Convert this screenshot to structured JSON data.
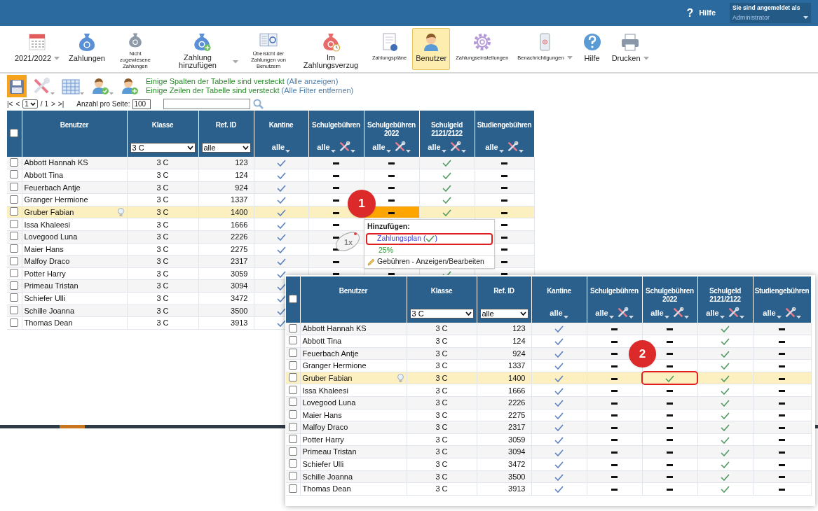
{
  "topbar": {
    "help_glyph": "?",
    "help": "Hilfe",
    "login_label": "Sie sind angemeldet als",
    "login_user": "Administrator"
  },
  "toolbar": [
    {
      "kind": "calendar",
      "label": "2021/2022",
      "dropdown": true,
      "minor": false,
      "selected": false
    },
    {
      "kind": "bag",
      "label": "Zahlungen",
      "dropdown": false,
      "minor": false,
      "selected": false
    },
    {
      "kind": "bag-question",
      "label": "Nicht zugewiesene Zahlungen",
      "dropdown": false,
      "minor": true,
      "selected": false
    },
    {
      "kind": "bag-add",
      "label": "Zahlung hinzufügen",
      "dropdown": true,
      "minor": false,
      "selected": false
    },
    {
      "kind": "book",
      "label": "Übersicht der Zahlungen von Benutzern",
      "dropdown": false,
      "minor": true,
      "selected": false
    },
    {
      "kind": "bag-clock",
      "label": "Im Zahlungsverzug",
      "dropdown": false,
      "minor": false,
      "selected": false
    },
    {
      "kind": "document",
      "label": "Zahlungspläne",
      "dropdown": false,
      "minor": true,
      "selected": false
    },
    {
      "kind": "user",
      "label": "Benutzer",
      "dropdown": false,
      "minor": false,
      "selected": true
    },
    {
      "kind": "gear",
      "label": "Zahlungseinstellungen",
      "dropdown": false,
      "minor": true,
      "selected": false
    },
    {
      "kind": "phone",
      "label": "Benachrichtigungen",
      "dropdown": true,
      "minor": true,
      "selected": false
    },
    {
      "kind": "help",
      "label": "Hilfe",
      "dropdown": false,
      "minor": false,
      "selected": false
    },
    {
      "kind": "printer",
      "label": "Drucken",
      "dropdown": true,
      "minor": false,
      "selected": false
    }
  ],
  "subtoolbar": {
    "tools": [
      {
        "kind": "save",
        "selected": true,
        "dropdown": false
      },
      {
        "kind": "tools",
        "selected": false,
        "dropdown": true
      },
      {
        "kind": "grid",
        "selected": false,
        "dropdown": true
      },
      {
        "kind": "user-check",
        "selected": false,
        "dropdown": true
      },
      {
        "kind": "user-add",
        "selected": false,
        "dropdown": false
      }
    ],
    "notices": [
      {
        "text": "Einige Spalten der Tabelle sind versteckt",
        "link": "(Alle anzeigen)"
      },
      {
        "text": "Einige Zeilen der Tabelle sind versteckt",
        "link": "(Alle Filter entfernen)"
      }
    ]
  },
  "pager": {
    "first": "|<",
    "prev": "<",
    "page": "1",
    "total": "/ 1",
    "next": ">",
    "last": ">|",
    "per_page_label": "Anzahl pro Seite:",
    "per_page": "100"
  },
  "table": {
    "all_checked": false,
    "columns": [
      {
        "label": "Benutzer",
        "kind": "name"
      },
      {
        "label": "Klasse",
        "kind": "select",
        "filter": "3 C"
      },
      {
        "label": "Ref. ID",
        "kind": "select",
        "filter": "alle"
      },
      {
        "label": "Kantine",
        "kind": "fee",
        "filter": "alle",
        "tools": false
      },
      {
        "label": "Schulgebühren",
        "kind": "fee",
        "filter": "alle",
        "tools": true
      },
      {
        "label": "Schulgebühren 2022",
        "kind": "fee",
        "filter": "alle",
        "tools": true
      },
      {
        "label": "Schulgeld 2121/2122",
        "kind": "fee",
        "filter": "alle",
        "tools": true
      },
      {
        "label": "Studiengebühren",
        "kind": "fee",
        "filter": "alle",
        "tools": true
      }
    ],
    "rows": [
      {
        "name": "Abbott Hannah KS",
        "klasse": "3 C",
        "ref": "123",
        "checked": false,
        "selected": false,
        "hint": false,
        "cells": {
          "kantine": {
            "kind": "booked"
          },
          "schulgebuehren": {
            "kind": "open"
          },
          "schulgebuehren_2022": {
            "kind": "open"
          },
          "schulgeld": {
            "kind": "paid"
          },
          "studiengebuehren": {
            "kind": "open"
          }
        }
      },
      {
        "name": "Abbott Tina",
        "klasse": "3 C",
        "ref": "124",
        "checked": false,
        "selected": false,
        "hint": false,
        "cells": {
          "kantine": {
            "kind": "booked"
          },
          "schulgebuehren": {
            "kind": "open"
          },
          "schulgebuehren_2022": {
            "kind": "open"
          },
          "schulgeld": {
            "kind": "paid"
          },
          "studiengebuehren": {
            "kind": "open"
          }
        }
      },
      {
        "name": "Feuerbach Antje",
        "klasse": "3 C",
        "ref": "924",
        "checked": false,
        "selected": false,
        "hint": false,
        "cells": {
          "kantine": {
            "kind": "booked"
          },
          "schulgebuehren": {
            "kind": "open"
          },
          "schulgebuehren_2022": {
            "kind": "open"
          },
          "schulgeld": {
            "kind": "paid"
          },
          "studiengebuehren": {
            "kind": "open"
          }
        }
      },
      {
        "name": "Granger Hermione",
        "klasse": "3 C",
        "ref": "1337",
        "checked": false,
        "selected": false,
        "hint": false,
        "cells": {
          "kantine": {
            "kind": "booked"
          },
          "schulgebuehren": {
            "kind": "open"
          },
          "schulgebuehren_2022": {
            "kind": "open"
          },
          "schulgeld": {
            "kind": "paid"
          },
          "studiengebuehren": {
            "kind": "open"
          }
        }
      },
      {
        "name": "Gruber Fabian",
        "klasse": "3 C",
        "ref": "1400",
        "checked": false,
        "selected": true,
        "hint": true,
        "cells": {
          "kantine": {
            "kind": "booked"
          },
          "schulgebuehren": {
            "kind": "open"
          },
          "schulgebuehren_2022": {
            "kind": "open",
            "focused": true
          },
          "schulgeld": {
            "kind": "paid"
          },
          "studiengebuehren": {
            "kind": "open"
          }
        }
      },
      {
        "name": "Issa Khaleesi",
        "klasse": "3 C",
        "ref": "1666",
        "checked": false,
        "selected": false,
        "hint": false,
        "cells": {
          "kantine": {
            "kind": "booked"
          },
          "schulgebuehren": {
            "kind": "open"
          },
          "studiengebuehren": {
            "kind": "open"
          }
        }
      },
      {
        "name": "Lovegood Luna",
        "klasse": "3 C",
        "ref": "2226",
        "checked": false,
        "selected": false,
        "hint": false,
        "cells": {
          "kantine": {
            "kind": "booked"
          },
          "schulgebuehren": {
            "kind": "open"
          },
          "studiengebuehren": {
            "kind": "open"
          }
        }
      },
      {
        "name": "Maier Hans",
        "klasse": "3 C",
        "ref": "2275",
        "checked": false,
        "selected": false,
        "hint": false,
        "cells": {
          "kantine": {
            "kind": "booked"
          },
          "schulgebuehren": {
            "kind": "open"
          },
          "studiengebuehren": {
            "kind": "open"
          }
        }
      },
      {
        "name": "Malfoy Draco",
        "klasse": "3 C",
        "ref": "2317",
        "checked": false,
        "selected": false,
        "hint": false,
        "cells": {
          "kantine": {
            "kind": "booked"
          },
          "schulgebuehren": {
            "kind": "open"
          },
          "studiengebuehren": {
            "kind": "open"
          }
        }
      },
      {
        "name": "Potter Harry",
        "klasse": "3 C",
        "ref": "3059",
        "checked": false,
        "selected": false,
        "hint": false,
        "cells": {
          "kantine": {
            "kind": "booked"
          },
          "schulgebuehren": {
            "kind": "open"
          },
          "schulgebuehren_2022": {
            "kind": "open"
          },
          "schulgeld": {
            "kind": "paid"
          },
          "studiengebuehren": {
            "kind": "open"
          }
        }
      },
      {
        "name": "Primeau Tristan",
        "klasse": "3 C",
        "ref": "3094",
        "checked": false,
        "selected": false,
        "hint": false,
        "cells": {
          "kantine": {
            "kind": "booked"
          }
        }
      },
      {
        "name": "Schiefer Ulli",
        "klasse": "3 C",
        "ref": "3472",
        "checked": false,
        "selected": false,
        "hint": false,
        "cells": {
          "kantine": {
            "kind": "booked"
          }
        }
      },
      {
        "name": "Schille Joanna",
        "klasse": "3 C",
        "ref": "3500",
        "checked": false,
        "selected": false,
        "hint": false,
        "cells": {
          "kantine": {
            "kind": "booked"
          }
        }
      },
      {
        "name": "Thomas Dean",
        "klasse": "3 C",
        "ref": "3913",
        "checked": false,
        "selected": false,
        "hint": false,
        "cells": {
          "kantine": {
            "kind": "booked"
          }
        }
      }
    ]
  },
  "popup": {
    "title": "Hinzufügen:",
    "plan_before": "Zahlungsplan (",
    "plan_after": ")",
    "percent": "25%",
    "edit": "Gebühren - Anzeigen/Bearbeiten"
  },
  "callouts": [
    "1",
    "2"
  ],
  "mouse_label": "1x",
  "overlay": {
    "table": {
      "all_checked": false,
      "columns": [
        {
          "label": "Benutzer",
          "kind": "name"
        },
        {
          "label": "Klasse",
          "kind": "select",
          "filter": "3 C"
        },
        {
          "label": "Ref. ID",
          "kind": "select",
          "filter": "alle"
        },
        {
          "label": "Kantine",
          "kind": "fee",
          "filter": "alle",
          "tools": false
        },
        {
          "label": "Schulgebühren",
          "kind": "fee",
          "filter": "alle",
          "tools": true
        },
        {
          "label": "Schulgebühren 2022",
          "kind": "fee",
          "filter": "alle",
          "tools": true
        },
        {
          "label": "Schulgeld 2121/2122",
          "kind": "fee",
          "filter": "alle",
          "tools": true
        },
        {
          "label": "Studiengebühren",
          "kind": "fee",
          "filter": "alle",
          "tools": true
        }
      ],
      "rows": [
        {
          "name": "Abbott Hannah KS",
          "klasse": "3 C",
          "ref": "123",
          "checked": false,
          "selected": false,
          "hint": false,
          "cells": {
            "kantine": {
              "kind": "booked"
            },
            "schulgebuehren": {
              "kind": "open"
            },
            "schulgebuehren_2022": {
              "kind": "open"
            },
            "schulgeld": {
              "kind": "paid"
            },
            "studiengebuehren": {
              "kind": "open"
            }
          }
        },
        {
          "name": "Abbott Tina",
          "klasse": "3 C",
          "ref": "124",
          "checked": false,
          "selected": false,
          "hint": false,
          "cells": {
            "kantine": {
              "kind": "booked"
            },
            "schulgebuehren": {
              "kind": "open"
            },
            "schulgebuehren_2022": {
              "kind": "open"
            },
            "schulgeld": {
              "kind": "paid"
            },
            "studiengebuehren": {
              "kind": "open"
            }
          }
        },
        {
          "name": "Feuerbach Antje",
          "klasse": "3 C",
          "ref": "924",
          "checked": false,
          "selected": false,
          "hint": false,
          "cells": {
            "kantine": {
              "kind": "booked"
            },
            "schulgebuehren": {
              "kind": "open"
            },
            "schulgebuehren_2022": {
              "kind": "open"
            },
            "schulgeld": {
              "kind": "paid"
            },
            "studiengebuehren": {
              "kind": "open"
            }
          }
        },
        {
          "name": "Granger Hermione",
          "klasse": "3 C",
          "ref": "1337",
          "checked": false,
          "selected": false,
          "hint": false,
          "cells": {
            "kantine": {
              "kind": "booked"
            },
            "schulgebuehren": {
              "kind": "open"
            },
            "schulgebuehren_2022": {
              "kind": "open"
            },
            "schulgeld": {
              "kind": "paid"
            },
            "studiengebuehren": {
              "kind": "open"
            }
          }
        },
        {
          "name": "Gruber Fabian",
          "klasse": "3 C",
          "ref": "1400",
          "checked": false,
          "selected": true,
          "hint": true,
          "cells": {
            "kantine": {
              "kind": "booked"
            },
            "schulgebuehren": {
              "kind": "open"
            },
            "schulgebuehren_2022": {
              "kind": "paid",
              "focused": true
            },
            "schulgeld": {
              "kind": "paid"
            },
            "studiengebuehren": {
              "kind": "open"
            }
          }
        },
        {
          "name": "Issa Khaleesi",
          "klasse": "3 C",
          "ref": "1666",
          "checked": false,
          "selected": false,
          "hint": false,
          "cells": {
            "kantine": {
              "kind": "booked"
            },
            "schulgebuehren": {
              "kind": "open"
            },
            "schulgebuehren_2022": {
              "kind": "open"
            },
            "schulgeld": {
              "kind": "paid"
            },
            "studiengebuehren": {
              "kind": "open"
            }
          }
        },
        {
          "name": "Lovegood Luna",
          "klasse": "3 C",
          "ref": "2226",
          "checked": false,
          "selected": false,
          "hint": false,
          "cells": {
            "kantine": {
              "kind": "booked"
            },
            "schulgebuehren": {
              "kind": "open"
            },
            "schulgebuehren_2022": {
              "kind": "open"
            },
            "schulgeld": {
              "kind": "paid"
            },
            "studiengebuehren": {
              "kind": "open"
            }
          }
        },
        {
          "name": "Maier Hans",
          "klasse": "3 C",
          "ref": "2275",
          "checked": false,
          "selected": false,
          "hint": false,
          "cells": {
            "kantine": {
              "kind": "booked"
            },
            "schulgebuehren": {
              "kind": "open"
            },
            "schulgebuehren_2022": {
              "kind": "open"
            },
            "schulgeld": {
              "kind": "paid"
            },
            "studiengebuehren": {
              "kind": "open"
            }
          }
        },
        {
          "name": "Malfoy Draco",
          "klasse": "3 C",
          "ref": "2317",
          "checked": false,
          "selected": false,
          "hint": false,
          "cells": {
            "kantine": {
              "kind": "booked"
            },
            "schulgebuehren": {
              "kind": "open"
            },
            "schulgebuehren_2022": {
              "kind": "open"
            },
            "schulgeld": {
              "kind": "paid"
            },
            "studiengebuehren": {
              "kind": "open"
            }
          }
        },
        {
          "name": "Potter Harry",
          "klasse": "3 C",
          "ref": "3059",
          "checked": false,
          "selected": false,
          "hint": false,
          "cells": {
            "kantine": {
              "kind": "booked"
            },
            "schulgebuehren": {
              "kind": "open"
            },
            "schulgebuehren_2022": {
              "kind": "open"
            },
            "schulgeld": {
              "kind": "paid"
            },
            "studiengebuehren": {
              "kind": "open"
            }
          }
        },
        {
          "name": "Primeau Tristan",
          "klasse": "3 C",
          "ref": "3094",
          "checked": false,
          "selected": false,
          "hint": false,
          "cells": {
            "kantine": {
              "kind": "booked"
            },
            "schulgebuehren": {
              "kind": "open"
            },
            "schulgebuehren_2022": {
              "kind": "open"
            },
            "schulgeld": {
              "kind": "paid"
            },
            "studiengebuehren": {
              "kind": "open"
            }
          }
        },
        {
          "name": "Schiefer Ulli",
          "klasse": "3 C",
          "ref": "3472",
          "checked": false,
          "selected": false,
          "hint": false,
          "cells": {
            "kantine": {
              "kind": "booked"
            },
            "schulgebuehren": {
              "kind": "open"
            },
            "schulgebuehren_2022": {
              "kind": "open"
            },
            "schulgeld": {
              "kind": "paid"
            },
            "studiengebuehren": {
              "kind": "open"
            }
          }
        },
        {
          "name": "Schille Joanna",
          "klasse": "3 C",
          "ref": "3500",
          "checked": false,
          "selected": false,
          "hint": false,
          "cells": {
            "kantine": {
              "kind": "booked"
            },
            "schulgebuehren": {
              "kind": "open"
            },
            "schulgebuehren_2022": {
              "kind": "open"
            },
            "schulgeld": {
              "kind": "paid"
            },
            "studiengebuehren": {
              "kind": "open"
            }
          }
        },
        {
          "name": "Thomas Dean",
          "klasse": "3 C",
          "ref": "3913",
          "checked": false,
          "selected": false,
          "hint": false,
          "cells": {
            "kantine": {
              "kind": "booked"
            },
            "schulgebuehren": {
              "kind": "open"
            },
            "schulgebuehren_2022": {
              "kind": "open"
            },
            "schulgeld": {
              "kind": "paid"
            },
            "studiengebuehren": {
              "kind": "open"
            }
          }
        }
      ]
    }
  }
}
